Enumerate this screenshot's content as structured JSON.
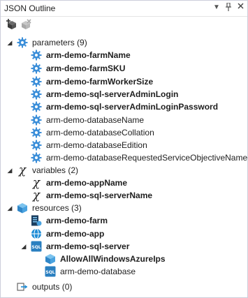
{
  "window": {
    "title": "JSON Outline"
  },
  "titlebar": {
    "dropdown_icon": "dropdown-arrow",
    "pin_icon": "pin",
    "close_icon": "close"
  },
  "toolbar": {
    "add_icon": "add-resource",
    "remove_icon": "remove-resource"
  },
  "tree": {
    "parameters": {
      "label": "parameters (9)",
      "items": [
        {
          "label": "arm-demo-farmName",
          "bold": true
        },
        {
          "label": "arm-demo-farmSKU",
          "bold": true
        },
        {
          "label": "arm-demo-farmWorkerSize",
          "bold": true
        },
        {
          "label": "arm-demo-sql-serverAdminLogin",
          "bold": true
        },
        {
          "label": "arm-demo-sql-serverAdminLoginPassword",
          "bold": true
        },
        {
          "label": "arm-demo-databaseName",
          "bold": false
        },
        {
          "label": "arm-demo-databaseCollation",
          "bold": false
        },
        {
          "label": "arm-demo-databaseEdition",
          "bold": false
        },
        {
          "label": "arm-demo-databaseRequestedServiceObjectiveName",
          "bold": false
        }
      ]
    },
    "variables": {
      "label": "variables (2)",
      "items": [
        {
          "label": "arm-demo-appName",
          "bold": true
        },
        {
          "label": "arm-demo-sql-serverName",
          "bold": true
        }
      ]
    },
    "resources": {
      "label": "resources (3)",
      "items": [
        {
          "label": "arm-demo-farm",
          "bold": true
        },
        {
          "label": "arm-demo-app",
          "bold": true
        },
        {
          "label": "arm-demo-sql-server",
          "bold": true,
          "children": [
            {
              "label": "AllowAllWindowsAzureIps",
              "bold": true
            },
            {
              "label": "arm-demo-database",
              "bold": false
            }
          ]
        }
      ]
    },
    "outputs": {
      "label": "outputs (0)"
    }
  },
  "colors": {
    "gear": "#3c8fd9",
    "cube": "#4aa3e0",
    "sql": "#2a7fc0",
    "web": "#1f8dd6",
    "farm": "#1b3d5e"
  }
}
